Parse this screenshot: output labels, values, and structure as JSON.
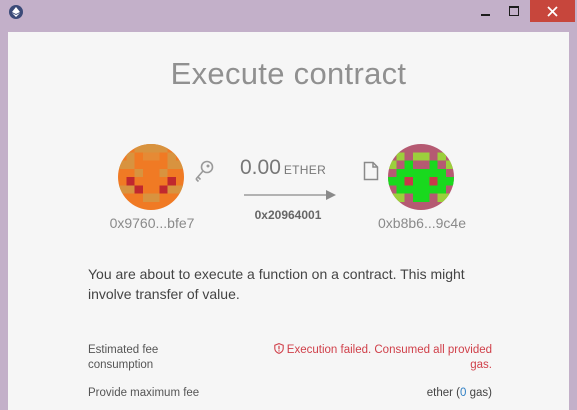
{
  "window": {
    "title_icon": "mist-icon",
    "controls": [
      "minimize",
      "maximize",
      "close"
    ],
    "close_color": "#c7463c",
    "frame_color": "#c3b0c9"
  },
  "dialog": {
    "title": "Execute contract",
    "from_address": "0x9760...bfe7",
    "to_address": "0xb8b6...9c4e",
    "amount": "0.00",
    "unit": "ETHER",
    "function_id": "0x20964001",
    "message": "You are about to execute a function on a contract. This might involve transfer of value."
  },
  "fee": {
    "estimated_label": "Estimated fee consumption",
    "error_text": "Execution failed. Consumed all provided gas.",
    "error_color": "#d0404a",
    "max_label": "Provide maximum fee",
    "max_unit": "ether (",
    "gas_value": "0",
    "gas_suffix": " gas)"
  },
  "icons": [
    "key-icon",
    "document-icon",
    "shield-alert-icon",
    "arrow-right-icon"
  ]
}
